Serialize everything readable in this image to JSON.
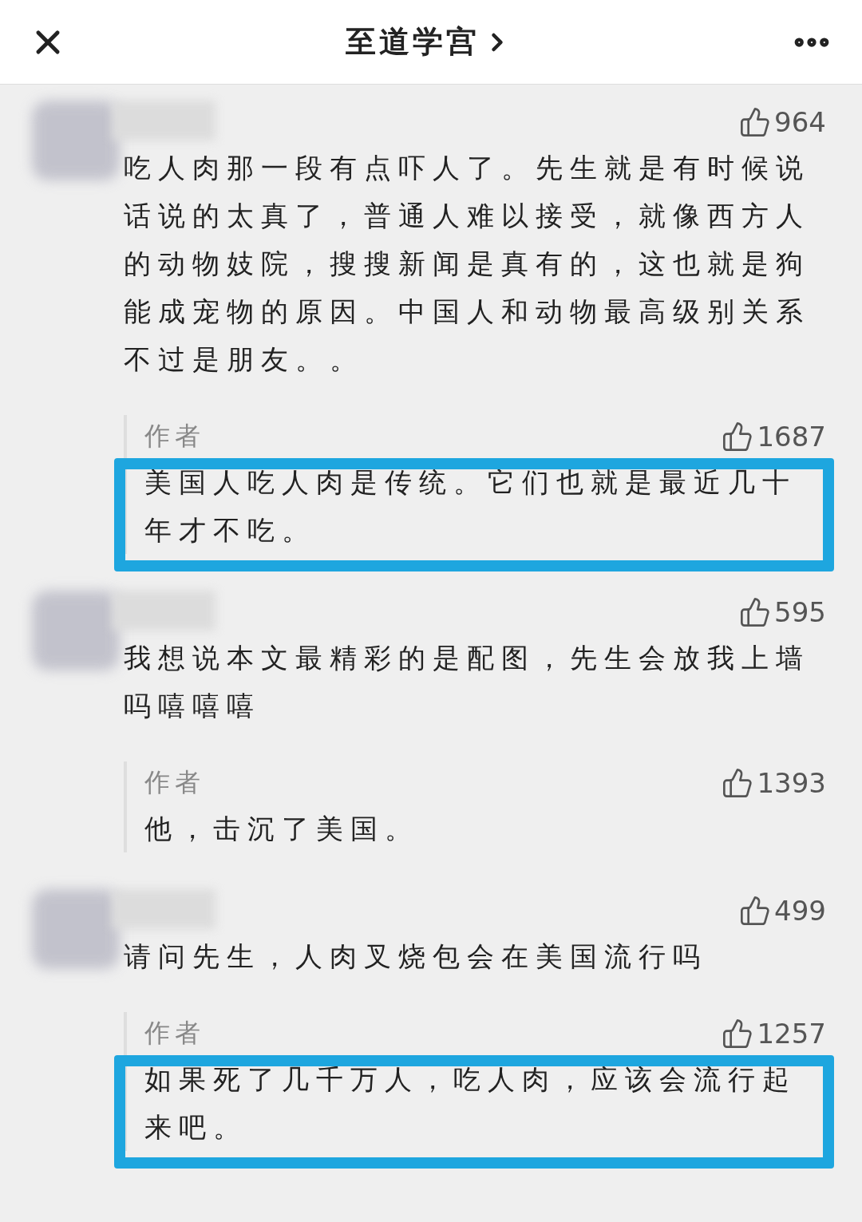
{
  "header": {
    "title": "至道学宫"
  },
  "comments": [
    {
      "likes": "964",
      "text": "吃人肉那一段有点吓人了。先生就是有时候说话说的太真了，普通人难以接受，就像西方人的动物妓院，搜搜新闻是真有的，这也就是狗能成宠物的原因。中国人和动物最高级别关系不过是朋友。。",
      "reply": {
        "author": "作者",
        "likes": "1687",
        "text": "美国人吃人肉是传统。它们也就是最近几十年才不吃。",
        "highlighted": true
      }
    },
    {
      "likes": "595",
      "text": "我想说本文最精彩的是配图，先生会放我上墙吗嘻嘻嘻",
      "reply": {
        "author": "作者",
        "likes": "1393",
        "text": "他，击沉了美国。",
        "highlighted": false
      }
    },
    {
      "likes": "499",
      "text": "请问先生，人肉叉烧包会在美国流行吗",
      "reply": {
        "author": "作者",
        "likes": "1257",
        "text": "如果死了几千万人，吃人肉，应该会流行起来吧。",
        "highlighted": true
      }
    }
  ]
}
